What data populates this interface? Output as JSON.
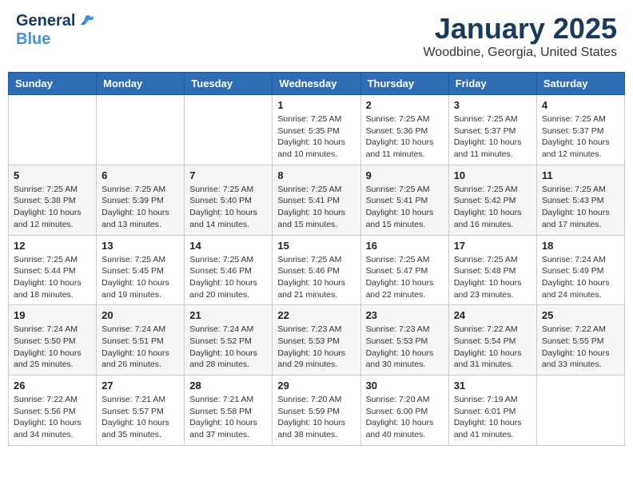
{
  "header": {
    "logo_general": "General",
    "logo_blue": "Blue",
    "title": "January 2025",
    "subtitle": "Woodbine, Georgia, United States"
  },
  "weekdays": [
    "Sunday",
    "Monday",
    "Tuesday",
    "Wednesday",
    "Thursday",
    "Friday",
    "Saturday"
  ],
  "weeks": [
    [
      {
        "day": "",
        "info": ""
      },
      {
        "day": "",
        "info": ""
      },
      {
        "day": "",
        "info": ""
      },
      {
        "day": "1",
        "info": "Sunrise: 7:25 AM\nSunset: 5:35 PM\nDaylight: 10 hours\nand 10 minutes."
      },
      {
        "day": "2",
        "info": "Sunrise: 7:25 AM\nSunset: 5:36 PM\nDaylight: 10 hours\nand 11 minutes."
      },
      {
        "day": "3",
        "info": "Sunrise: 7:25 AM\nSunset: 5:37 PM\nDaylight: 10 hours\nand 11 minutes."
      },
      {
        "day": "4",
        "info": "Sunrise: 7:25 AM\nSunset: 5:37 PM\nDaylight: 10 hours\nand 12 minutes."
      }
    ],
    [
      {
        "day": "5",
        "info": "Sunrise: 7:25 AM\nSunset: 5:38 PM\nDaylight: 10 hours\nand 12 minutes."
      },
      {
        "day": "6",
        "info": "Sunrise: 7:25 AM\nSunset: 5:39 PM\nDaylight: 10 hours\nand 13 minutes."
      },
      {
        "day": "7",
        "info": "Sunrise: 7:25 AM\nSunset: 5:40 PM\nDaylight: 10 hours\nand 14 minutes."
      },
      {
        "day": "8",
        "info": "Sunrise: 7:25 AM\nSunset: 5:41 PM\nDaylight: 10 hours\nand 15 minutes."
      },
      {
        "day": "9",
        "info": "Sunrise: 7:25 AM\nSunset: 5:41 PM\nDaylight: 10 hours\nand 15 minutes."
      },
      {
        "day": "10",
        "info": "Sunrise: 7:25 AM\nSunset: 5:42 PM\nDaylight: 10 hours\nand 16 minutes."
      },
      {
        "day": "11",
        "info": "Sunrise: 7:25 AM\nSunset: 5:43 PM\nDaylight: 10 hours\nand 17 minutes."
      }
    ],
    [
      {
        "day": "12",
        "info": "Sunrise: 7:25 AM\nSunset: 5:44 PM\nDaylight: 10 hours\nand 18 minutes."
      },
      {
        "day": "13",
        "info": "Sunrise: 7:25 AM\nSunset: 5:45 PM\nDaylight: 10 hours\nand 19 minutes."
      },
      {
        "day": "14",
        "info": "Sunrise: 7:25 AM\nSunset: 5:46 PM\nDaylight: 10 hours\nand 20 minutes."
      },
      {
        "day": "15",
        "info": "Sunrise: 7:25 AM\nSunset: 5:46 PM\nDaylight: 10 hours\nand 21 minutes."
      },
      {
        "day": "16",
        "info": "Sunrise: 7:25 AM\nSunset: 5:47 PM\nDaylight: 10 hours\nand 22 minutes."
      },
      {
        "day": "17",
        "info": "Sunrise: 7:25 AM\nSunset: 5:48 PM\nDaylight: 10 hours\nand 23 minutes."
      },
      {
        "day": "18",
        "info": "Sunrise: 7:24 AM\nSunset: 5:49 PM\nDaylight: 10 hours\nand 24 minutes."
      }
    ],
    [
      {
        "day": "19",
        "info": "Sunrise: 7:24 AM\nSunset: 5:50 PM\nDaylight: 10 hours\nand 25 minutes."
      },
      {
        "day": "20",
        "info": "Sunrise: 7:24 AM\nSunset: 5:51 PM\nDaylight: 10 hours\nand 26 minutes."
      },
      {
        "day": "21",
        "info": "Sunrise: 7:24 AM\nSunset: 5:52 PM\nDaylight: 10 hours\nand 28 minutes."
      },
      {
        "day": "22",
        "info": "Sunrise: 7:23 AM\nSunset: 5:53 PM\nDaylight: 10 hours\nand 29 minutes."
      },
      {
        "day": "23",
        "info": "Sunrise: 7:23 AM\nSunset: 5:53 PM\nDaylight: 10 hours\nand 30 minutes."
      },
      {
        "day": "24",
        "info": "Sunrise: 7:22 AM\nSunset: 5:54 PM\nDaylight: 10 hours\nand 31 minutes."
      },
      {
        "day": "25",
        "info": "Sunrise: 7:22 AM\nSunset: 5:55 PM\nDaylight: 10 hours\nand 33 minutes."
      }
    ],
    [
      {
        "day": "26",
        "info": "Sunrise: 7:22 AM\nSunset: 5:56 PM\nDaylight: 10 hours\nand 34 minutes."
      },
      {
        "day": "27",
        "info": "Sunrise: 7:21 AM\nSunset: 5:57 PM\nDaylight: 10 hours\nand 35 minutes."
      },
      {
        "day": "28",
        "info": "Sunrise: 7:21 AM\nSunset: 5:58 PM\nDaylight: 10 hours\nand 37 minutes."
      },
      {
        "day": "29",
        "info": "Sunrise: 7:20 AM\nSunset: 5:59 PM\nDaylight: 10 hours\nand 38 minutes."
      },
      {
        "day": "30",
        "info": "Sunrise: 7:20 AM\nSunset: 6:00 PM\nDaylight: 10 hours\nand 40 minutes."
      },
      {
        "day": "31",
        "info": "Sunrise: 7:19 AM\nSunset: 6:01 PM\nDaylight: 10 hours\nand 41 minutes."
      },
      {
        "day": "",
        "info": ""
      }
    ]
  ]
}
